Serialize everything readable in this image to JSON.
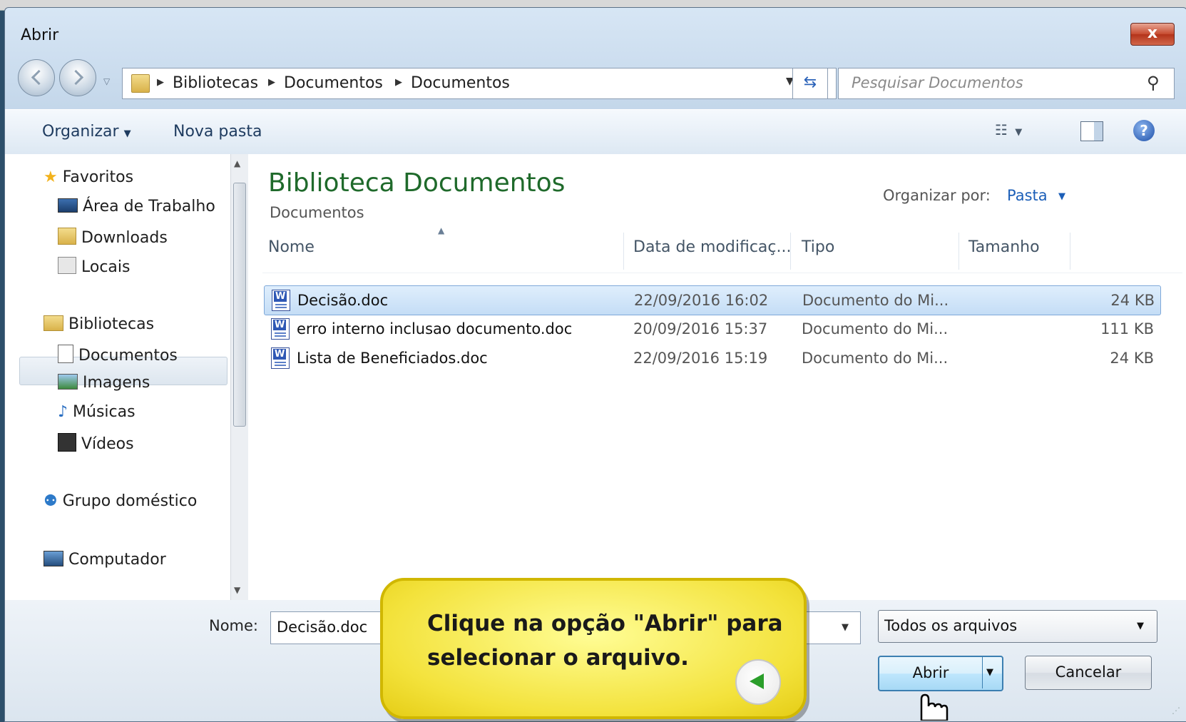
{
  "window": {
    "title": "Abrir",
    "close_label": "x"
  },
  "address_bar": {
    "crumbs": [
      "Bibliotecas",
      "Documentos",
      "Documentos"
    ],
    "search_placeholder": "Pesquisar Documentos"
  },
  "toolbar": {
    "organize": "Organizar",
    "new_folder": "Nova pasta",
    "help": "?"
  },
  "nav_pane": {
    "favorites": "Favoritos",
    "favorites_items": [
      "Área de Trabalho",
      "Downloads",
      "Locais"
    ],
    "libraries": "Bibliotecas",
    "libraries_items": [
      "Documentos",
      "Imagens",
      "Músicas",
      "Vídeos"
    ],
    "homegroup": "Grupo doméstico",
    "computer": "Computador"
  },
  "content": {
    "library_title": "Biblioteca Documentos",
    "library_subtitle": "Documentos",
    "arrange_label": "Organizar por:",
    "arrange_value": "Pasta",
    "columns": [
      "Nome",
      "Data de modificaç...",
      "Tipo",
      "Tamanho"
    ],
    "files": [
      {
        "name": "Decisão.doc",
        "date": "22/09/2016 16:02",
        "type": "Documento do Mi...",
        "size": "24 KB",
        "selected": true
      },
      {
        "name": "erro interno inclusao documento.doc",
        "date": "20/09/2016 15:37",
        "type": "Documento do Mi...",
        "size": "111 KB",
        "selected": false
      },
      {
        "name": "Lista de Beneficiados.doc",
        "date": "22/09/2016 15:19",
        "type": "Documento do Mi...",
        "size": "24 KB",
        "selected": false
      }
    ]
  },
  "bottom": {
    "name_label": "Nome:",
    "name_value": "Decisão.doc",
    "filter_value": "Todos os arquivos",
    "open_label": "Abrir",
    "cancel_label": "Cancelar"
  },
  "callout": {
    "text": "Clique na opção \"Abrir\" para selecionar o arquivo."
  },
  "colors": {
    "library_title": "#1f6a2b",
    "link": "#1c5fb8",
    "callout_bg": "#f3e23b",
    "selection": "#c4ddf6"
  }
}
